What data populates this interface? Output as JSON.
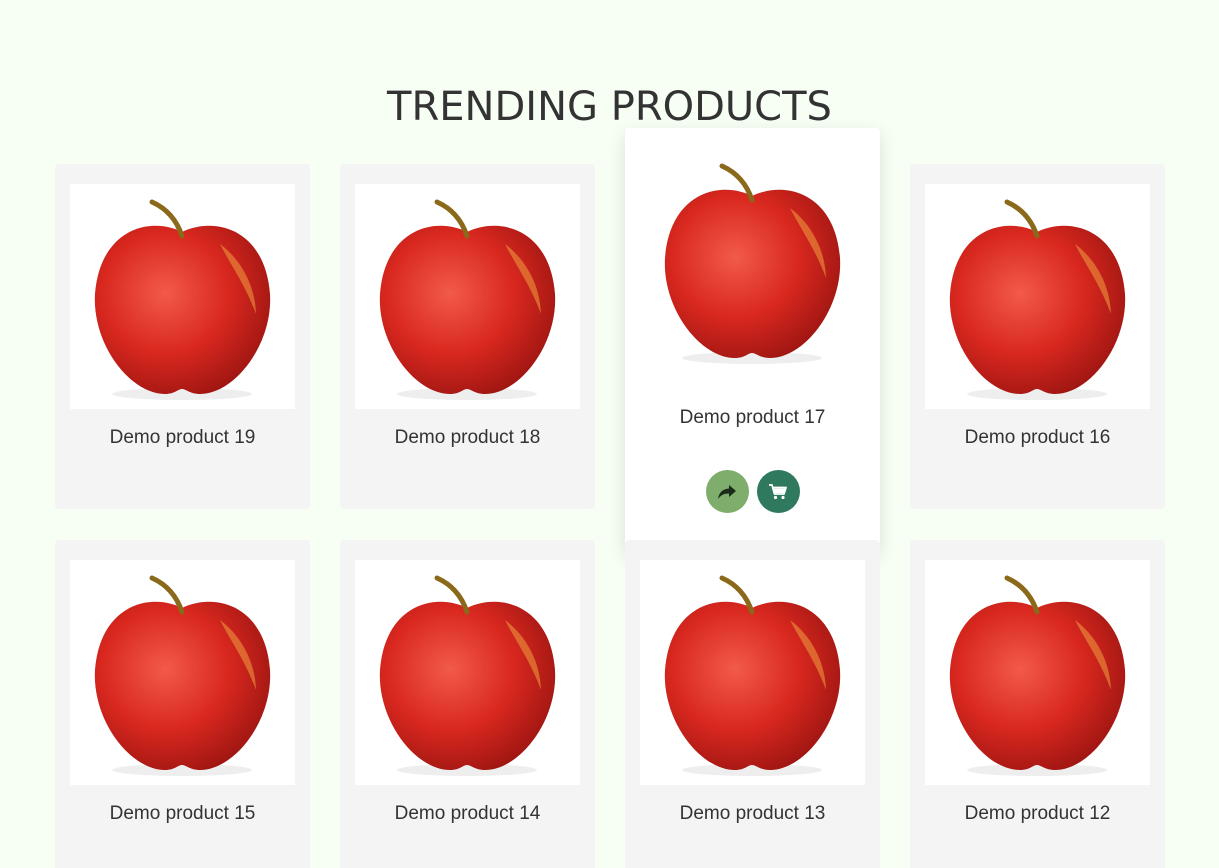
{
  "section": {
    "title": "TRENDING PRODUCTS"
  },
  "products": [
    {
      "name": "Demo product 19",
      "image_icon": "apple-image"
    },
    {
      "name": "Demo product 18",
      "image_icon": "apple-image"
    },
    {
      "name": "Demo product 17",
      "image_icon": "apple-image",
      "hovered": true
    },
    {
      "name": "Demo product 16",
      "image_icon": "apple-image"
    },
    {
      "name": "Demo product 15",
      "image_icon": "apple-image"
    },
    {
      "name": "Demo product 14",
      "image_icon": "apple-image"
    },
    {
      "name": "Demo product 13",
      "image_icon": "apple-image"
    },
    {
      "name": "Demo product 12",
      "image_icon": "apple-image"
    }
  ],
  "actions": {
    "share_icon": "share-arrow-icon",
    "cart_icon": "cart-icon"
  },
  "colors": {
    "background": "#f7fff5",
    "card": "#f4f4f4",
    "share_button": "#7fad6b",
    "cart_button": "#2f7a5e",
    "text": "#333333"
  }
}
